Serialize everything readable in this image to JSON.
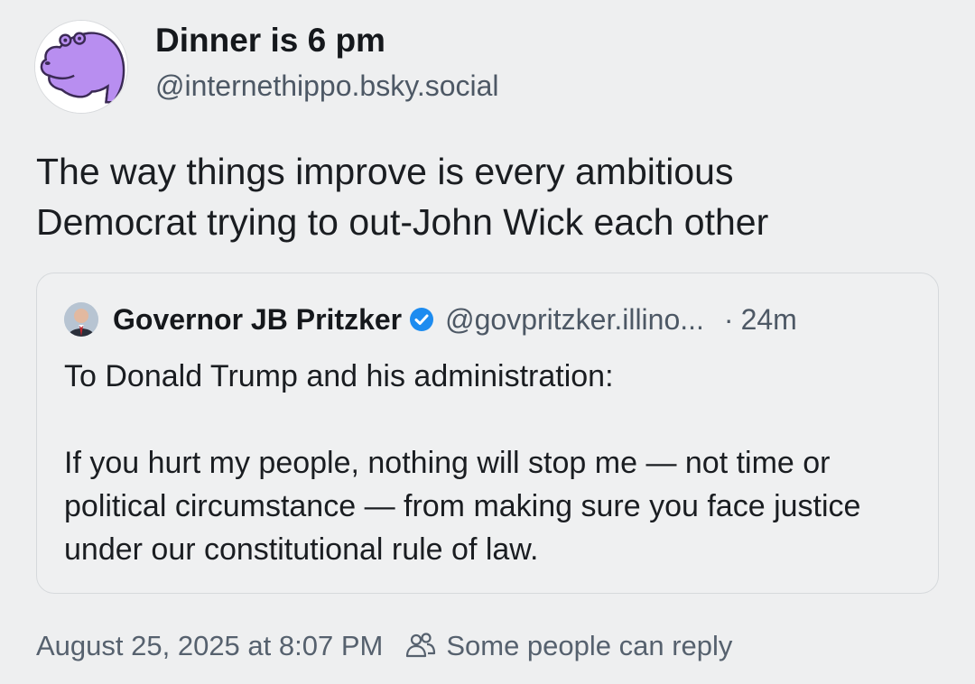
{
  "post": {
    "author": {
      "display_name": "Dinner is 6 pm",
      "handle": "@internethippo.bsky.social",
      "avatar_icon": "purple-hippo-avatar"
    },
    "text_lines": [
      "The way things improve is every ambitious",
      "Democrat trying to out-John Wick each other"
    ],
    "quote": {
      "author": {
        "display_name": "Governor JB Pritzker",
        "verified_icon": "verified-check-icon",
        "handle": "@govpritzker.illino...",
        "time_separator": "·",
        "time": "24m"
      },
      "paragraphs": [
        "To Donald Trump and his administration:",
        "If you hurt my people, nothing will stop me — not time or political circumstance — from making sure you face justice under our constitutional rule of law."
      ]
    },
    "meta": {
      "timestamp": "August 25, 2025 at 8:07 PM",
      "reply_icon": "people-icon",
      "reply_setting": "Some people can reply"
    }
  },
  "colors": {
    "background": "#eeeff0",
    "verified_blue": "#1d8cf0",
    "hippo_purple": "#b88ef0",
    "muted_text": "#4d5865"
  }
}
